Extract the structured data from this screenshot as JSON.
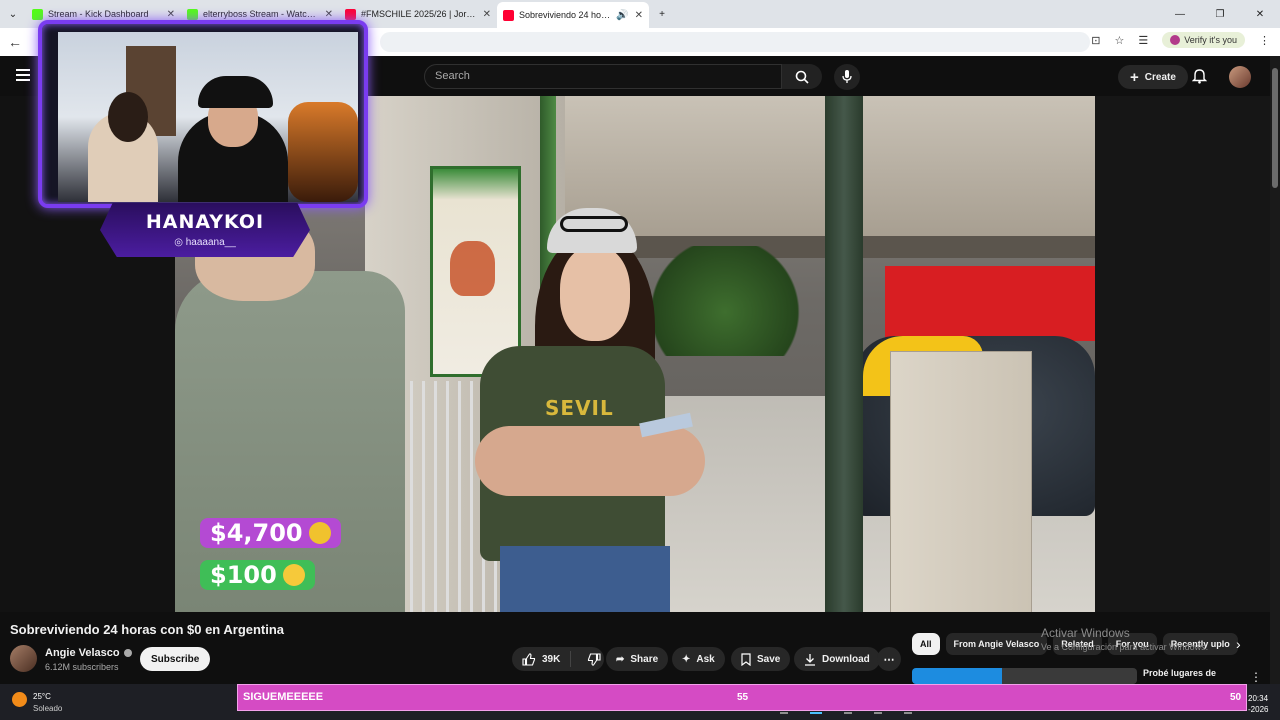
{
  "browser": {
    "tabs": [
      {
        "title": "Stream - Kick Dashboard",
        "favicon_color": "#53fc18",
        "active": false
      },
      {
        "title": "elterryboss Stream - Watch Live",
        "favicon_color": "#53fc18",
        "active": false
      },
      {
        "title": "#FMSCHILE 2025/26 | Jornada",
        "favicon_color": "#ff0033",
        "active": false
      },
      {
        "title": "Sobreviviendo 24 horas con",
        "favicon_color": "#ff0033",
        "active": true
      }
    ],
    "new_tab_symbol": "+",
    "verify_label": "Verify it's you"
  },
  "youtube": {
    "search_placeholder": "Search",
    "create_label": "Create",
    "video": {
      "title": "Sobreviviendo 24 horas con $0 en Argentina",
      "shirt_text": "SEVIL"
    },
    "channel": {
      "name": "Angie Velasco",
      "subscribers": "6.12M subscribers",
      "subscribe_label": "Subscribe"
    },
    "actions": {
      "likes": "39K",
      "share": "Share",
      "ask": "Ask",
      "save": "Save",
      "download": "Download"
    },
    "chips": [
      "All",
      "From Angie Velasco",
      "Related",
      "For you",
      "Recently uplo"
    ],
    "recommended": {
      "thumb_title": "Probé lugares de"
    }
  },
  "stream_overlay": {
    "streamer_name": "HANAYKOI",
    "handle": "haaaana__",
    "donations": [
      "$4,700",
      "$100"
    ],
    "banner_message": "SIGUEMEEEEE",
    "banner_number_1": "55",
    "banner_number_2": "50"
  },
  "windows": {
    "activate_title": "Activar Windows",
    "activate_sub": "Ve a Configuración para activar Windows.",
    "weather_temp": "25°C",
    "weather_desc": "Soleado",
    "time": "20:34",
    "date": "-2026"
  },
  "colors": {
    "youtube_red": "#ff0033",
    "overlay_purple": "#7a3cf0",
    "banner_pink": "#d54bc4",
    "donation_purple": "#b44ad3",
    "donation_green": "#3fbe57"
  }
}
